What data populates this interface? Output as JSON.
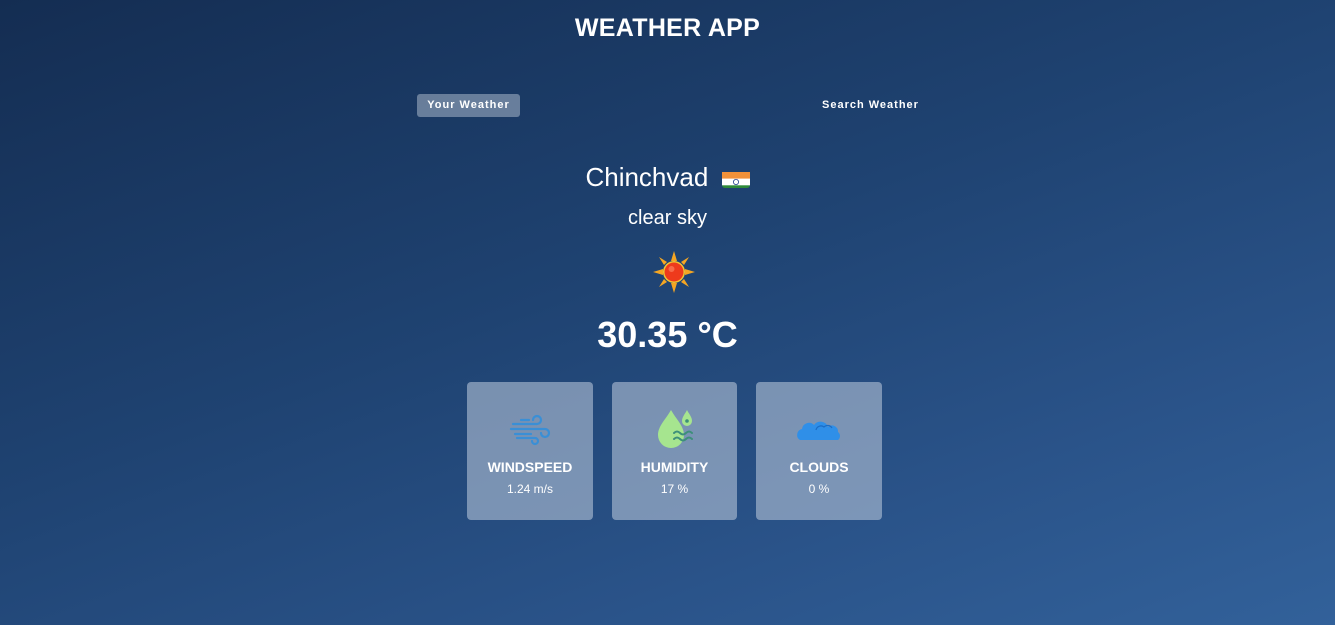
{
  "app": {
    "title": "WEATHER APP"
  },
  "tabs": [
    {
      "label": "Your Weather",
      "active": true
    },
    {
      "label": "Search Weather",
      "active": false
    }
  ],
  "weather": {
    "city": "Chinchvad",
    "country_flag": "india-flag-icon",
    "description": "clear sky",
    "condition_icon": "sun-icon",
    "temperature": "30.35 °C"
  },
  "stats": [
    {
      "label": "WINDSPEED",
      "value": "1.24 m/s",
      "icon": "wind-icon"
    },
    {
      "label": "HUMIDITY",
      "value": "17 %",
      "icon": "humidity-icon"
    },
    {
      "label": "CLOUDS",
      "value": "0 %",
      "icon": "cloud-icon"
    }
  ],
  "colors": {
    "background_top": "#142d52",
    "background_bottom": "#32619a",
    "card_background": "#8fa2bd",
    "wind_icon": "#3a8fd6",
    "humidity_icon": "#9be08a",
    "cloud_icon": "#2f8fe8"
  }
}
